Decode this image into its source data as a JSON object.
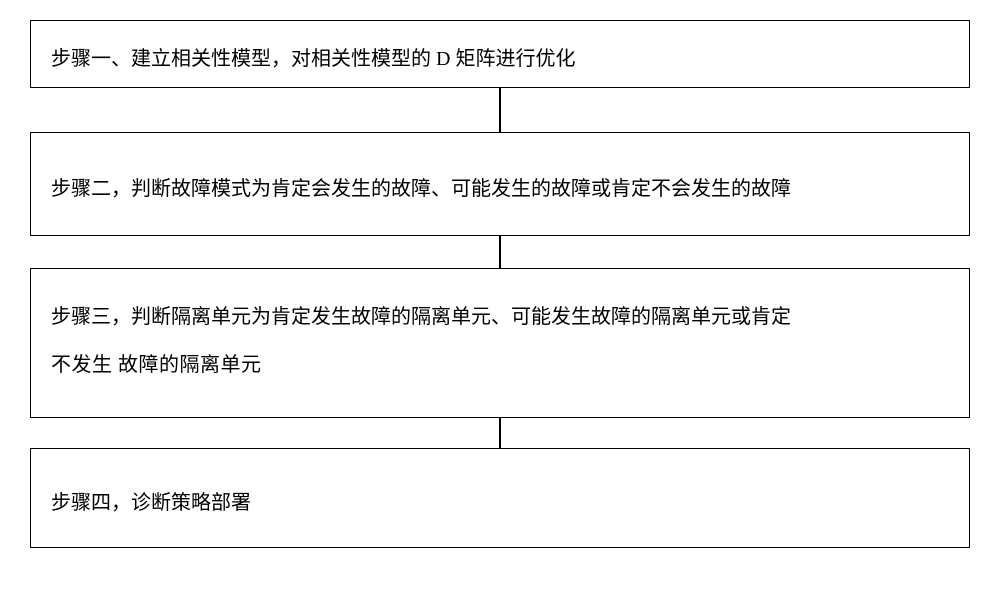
{
  "flowchart": {
    "steps": [
      {
        "text": "步骤一、建立相关性模型，对相关性模型的 D 矩阵进行优化"
      },
      {
        "text": "步骤二，判断故障模式为肯定会发生的故障、可能发生的故障或肯定不会发生的故障"
      },
      {
        "line1": "步骤三，判断隔离单元为肯定发生故障的隔离单元、可能发生故障的隔离单元或肯定",
        "line2": "不发生 故障的隔离单元"
      },
      {
        "text": "步骤四，诊断策略部署"
      }
    ]
  }
}
